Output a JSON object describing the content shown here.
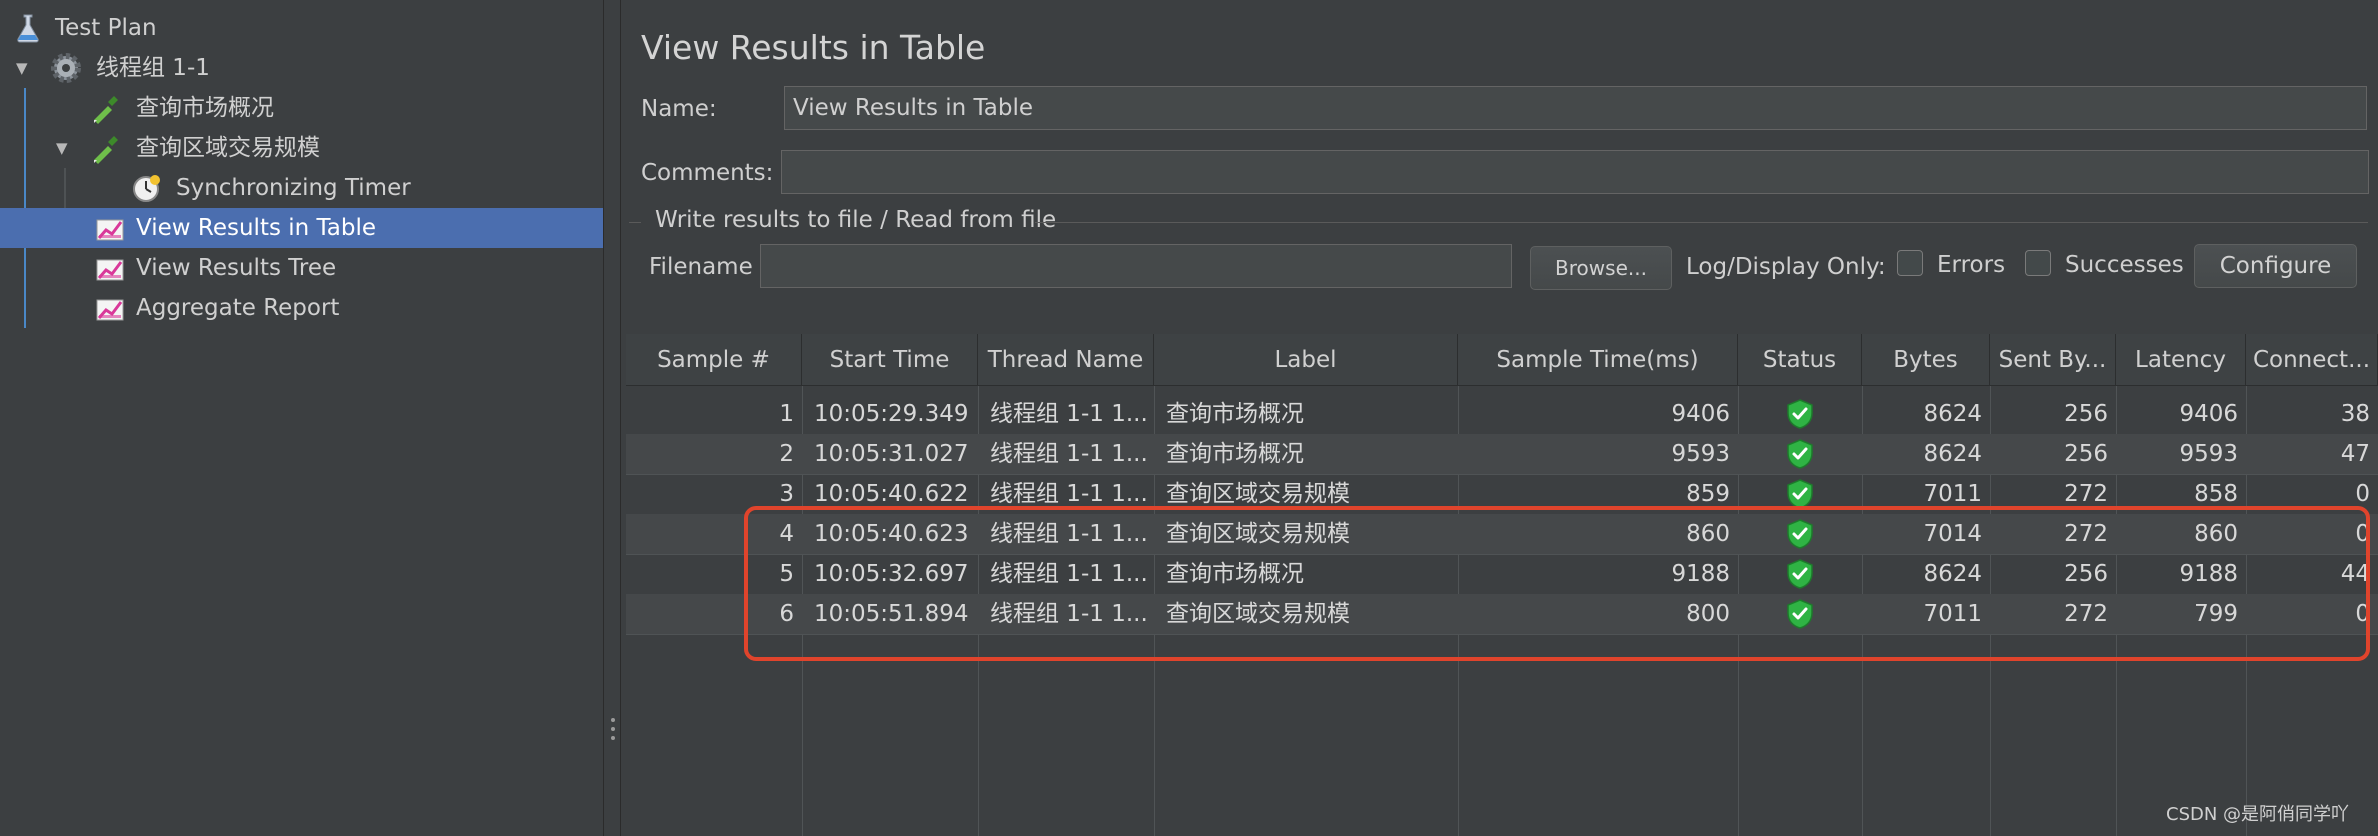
{
  "tree": {
    "items": [
      {
        "label": "Test Plan"
      },
      {
        "label": "线程组 1-1"
      },
      {
        "label": "查询市场概况"
      },
      {
        "label": "查询区域交易规模"
      },
      {
        "label": "Synchronizing Timer"
      },
      {
        "label": "View Results in Table"
      },
      {
        "label": "View Results Tree"
      },
      {
        "label": "Aggregate Report"
      }
    ]
  },
  "panel": {
    "title": "View Results in Table",
    "name_label": "Name:",
    "name_value": "View Results in Table",
    "comments_label": "Comments:",
    "comments_value": "",
    "file_group_label": "Write results to file / Read from file",
    "filename_label": "Filename",
    "filename_value": "",
    "browse_label": "Browse...",
    "log_display_label": "Log/Display Only:",
    "errors_label": "Errors",
    "successes_label": "Successes",
    "configure_label": "Configure"
  },
  "table": {
    "columns": [
      "Sample #",
      "Start Time",
      "Thread Name",
      "Label",
      "Sample Time(ms)",
      "Status",
      "Bytes",
      "Sent By...",
      "Latency",
      "Connect..."
    ],
    "rows": [
      [
        "1",
        "10:05:29.349",
        "线程组 1-1 1...",
        "查询市场概况",
        "9406",
        "success",
        "8624",
        "256",
        "9406",
        "38"
      ],
      [
        "2",
        "10:05:31.027",
        "线程组 1-1 1...",
        "查询市场概况",
        "9593",
        "success",
        "8624",
        "256",
        "9593",
        "47"
      ],
      [
        "3",
        "10:05:40.622",
        "线程组 1-1 1...",
        "查询区域交易规模",
        "859",
        "success",
        "7011",
        "272",
        "858",
        "0"
      ],
      [
        "4",
        "10:05:40.623",
        "线程组 1-1 1...",
        "查询区域交易规模",
        "860",
        "success",
        "7014",
        "272",
        "860",
        "0"
      ],
      [
        "5",
        "10:05:32.697",
        "线程组 1-1 1...",
        "查询市场概况",
        "9188",
        "success",
        "8624",
        "256",
        "9188",
        "44"
      ],
      [
        "6",
        "10:05:51.894",
        "线程组 1-1 1...",
        "查询区域交易规模",
        "800",
        "success",
        "7011",
        "272",
        "799",
        "0"
      ]
    ]
  },
  "watermark": "CSDN @是阿俏同学吖",
  "colors": {
    "background": "#3c3f41",
    "selection": "#4b6eaf",
    "highlight_border": "#e0442c",
    "status_success": "#2fb344"
  }
}
